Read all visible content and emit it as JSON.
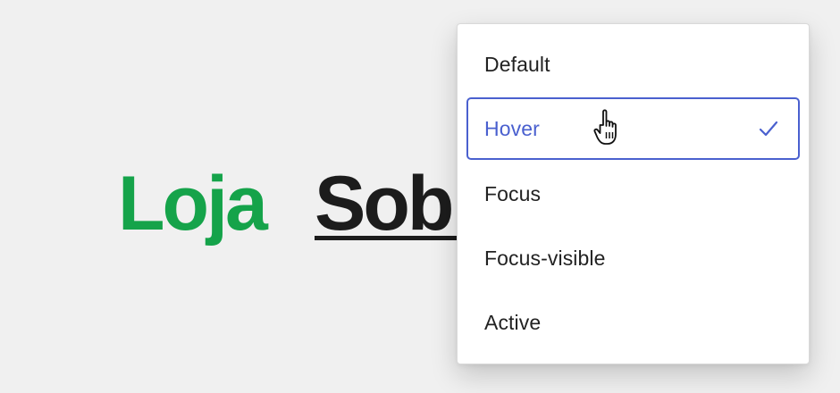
{
  "colors": {
    "green": "#15a34a",
    "accent": "#4a60cf",
    "text": "#222222",
    "background": "#f0f0f0"
  },
  "nav": {
    "loja_label": "Loja",
    "sobre_label": "Sobre"
  },
  "menu": {
    "items": [
      {
        "label": "Default",
        "state": "normal"
      },
      {
        "label": "Hover",
        "state": "hover",
        "selected": true
      },
      {
        "label": "Focus",
        "state": "normal"
      },
      {
        "label": "Focus-visible",
        "state": "normal"
      },
      {
        "label": "Active",
        "state": "normal"
      }
    ],
    "selected_indicator_icon": "checkmark-icon",
    "pointer_icon": "hand-pointer-cursor-icon"
  }
}
